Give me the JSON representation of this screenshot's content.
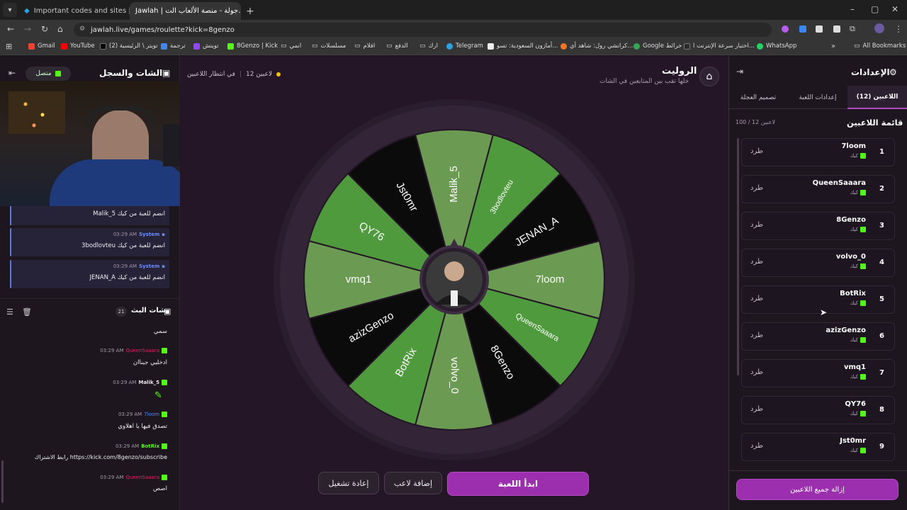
{
  "browser": {
    "tabs": [
      {
        "label": "Important codes and sites | ...",
        "active": false
      },
      {
        "label": "Jawlah | جولة - منصة الألعاب الت...",
        "active": true
      }
    ],
    "new_tab": "+",
    "url": "jawlah.live/games/roulette?kick=8genzo",
    "bookmarks": [
      "Gmail",
      "YouTube",
      "(2) تويتر \\ الرئيسية",
      "ترجمة",
      "تويتش",
      "8Genzo | Kick",
      "انمي",
      "مسلسلات",
      "افلام",
      "الدفع",
      "ارك",
      "Telegram",
      "أمازون السعودية: تسو...",
      "كرانشي رول: شاهد أي...",
      "Google خرائط",
      "اختبار سرعة الإنترنت ا...",
      "WhatsApp"
    ],
    "all_bookmarks": "All Bookmarks"
  },
  "left": {
    "title": "الشات والسجل",
    "status": "متصل",
    "system_msgs": [
      {
        "text": "Malik_5 انضم للعبة من كيك"
      },
      {
        "label": "System",
        "time": "03:29 AM",
        "text": "3bodlovteu انضم للعبة من كيك"
      },
      {
        "label": "System",
        "time": "03:29 AM",
        "text": "JENAN_A انضم للعبة من كيك"
      }
    ],
    "chat_title": "شات البث",
    "chat_count": "21",
    "chat": [
      {
        "user": "",
        "time": "",
        "text": "سمي",
        "color": "#ffffff"
      },
      {
        "user": "QueenSaaara",
        "time": "03:29 AM",
        "text": "ادخليي جيناان",
        "color": "#e0245e"
      },
      {
        "user": "Malik_5",
        "time": "03:29 AM",
        "text": "",
        "color": "#e8e2ea"
      },
      {
        "user": "7loom",
        "time": "03:29 AM",
        "text": "تصدق فيها يا اهلاوي",
        "color": "#4b8cff"
      },
      {
        "user": "BotRix",
        "time": "03:29 AM",
        "text": "رابط الاشتراك https://kick.com/8genzo/subscribe",
        "color": "#53fc18"
      },
      {
        "user": "QueenSaaara",
        "time": "03:29 AM",
        "text": "اصص",
        "color": "#e0245e"
      }
    ]
  },
  "center": {
    "title": "الروليت",
    "subtitle": "خلها تقب بين المتابعين في الشات",
    "players_count": "12 لاعبين",
    "waiting": "في انتظار اللاعبين",
    "wheel": [
      "JENAN_A",
      "7loom",
      "QueenSaaara",
      "8Genzo",
      "volvo_0",
      "BotRix",
      "azizGenzo",
      "vmq1",
      "QY76",
      "Jst0mr",
      "Malik_5",
      "3bodlovteu"
    ],
    "colors": {
      "green": "#4f9a3d",
      "light_green": "#6b9a52",
      "black": "#0b0b0b",
      "accent": "#9b2fae"
    },
    "start": "ابدأ اللعبة",
    "add_player": "إضافة لاعب",
    "restart": "إعادة تشغيل"
  },
  "right": {
    "title": "الإعدادات",
    "tabs": [
      "اللاعبين (12)",
      "إعدادات اللعبة",
      "تصميم العجلة"
    ],
    "list_title": "قائمة اللاعبين",
    "list_count": "100 / 12 لاعبين",
    "kick_label": "طرد",
    "platform": "كيك",
    "players": [
      {
        "n": "1",
        "name": "7loom"
      },
      {
        "n": "2",
        "name": "QueenSaaara"
      },
      {
        "n": "3",
        "name": "8Genzo"
      },
      {
        "n": "4",
        "name": "volvo_0"
      },
      {
        "n": "5",
        "name": "BotRix"
      },
      {
        "n": "6",
        "name": "azizGenzo"
      },
      {
        "n": "7",
        "name": "vmq1"
      },
      {
        "n": "8",
        "name": "QY76"
      },
      {
        "n": "9",
        "name": "Jst0mr"
      }
    ],
    "remove_all": "إزالة جميع اللاعبين"
  }
}
